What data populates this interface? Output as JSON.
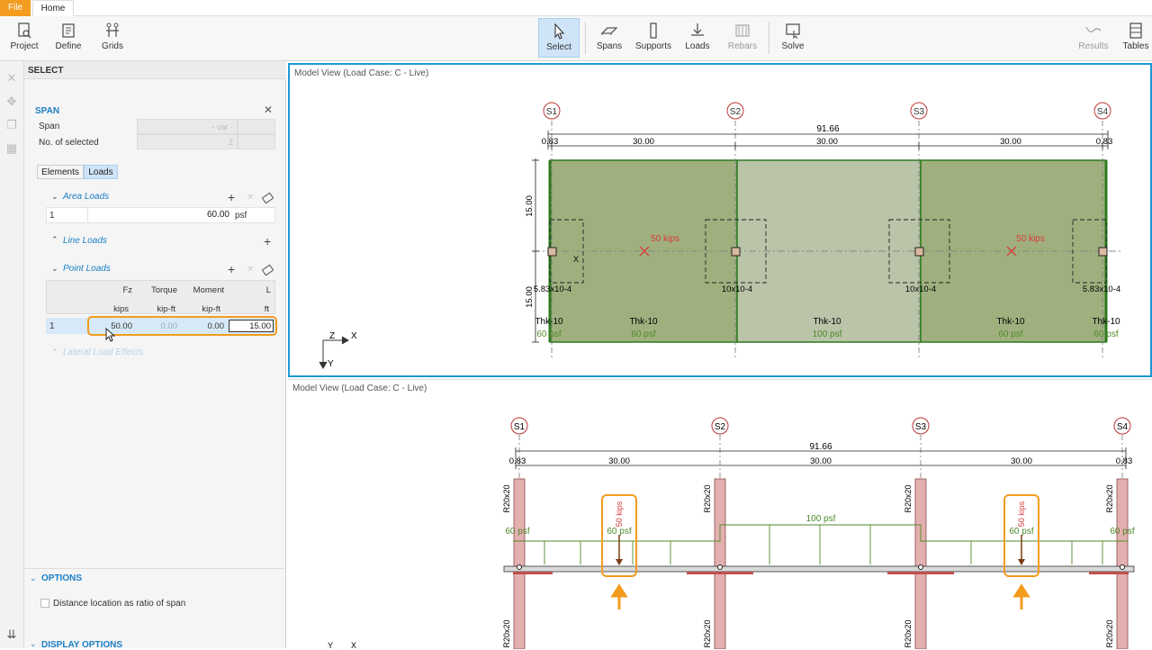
{
  "tabs": {
    "file": "File",
    "home": "Home"
  },
  "ribbon": {
    "project": "Project",
    "define": "Define",
    "grids": "Grids",
    "select": "Select",
    "spans": "Spans",
    "supports": "Supports",
    "loads": "Loads",
    "rebars": "Rebars",
    "solve": "Solve",
    "results": "Results",
    "tables": "Tables"
  },
  "panel": {
    "select_title": "SELECT",
    "span_title": "SPAN",
    "span_label": "Span",
    "span_value": "- var -",
    "selected_label": "No. of selected",
    "selected_value": "2",
    "tab_elements": "Elements",
    "tab_loads": "Loads",
    "area_loads": "Area Loads",
    "area_row_index": "1",
    "area_row_value": "60.00",
    "area_row_unit": "psf",
    "line_loads": "Line Loads",
    "point_loads": "Point Loads",
    "pt_headers": [
      "Fz",
      "Torque",
      "Moment",
      "L"
    ],
    "pt_units": [
      "kips",
      "kip-ft",
      "kip-ft",
      "ft"
    ],
    "pt_row": {
      "index": "1",
      "fz": "50.00",
      "torque": "0.00",
      "moment": "0.00",
      "l": "15.00"
    },
    "lateral": "Lateral Load Effects",
    "options_title": "OPTIONS",
    "options_check": "Distance location as ratio of span",
    "display_title": "DISPLAY OPTIONS"
  },
  "views": {
    "top_title": "Model View (Load Case: C - Live)",
    "bottom_title": "Model View (Load Case: C - Live)"
  },
  "model": {
    "grid_labels": [
      "S1",
      "S2",
      "S3",
      "S4"
    ],
    "total_dim": "91.66",
    "dims": [
      "0.83",
      "30.00",
      "30.00",
      "30.00",
      "0.83"
    ],
    "height_dims": [
      "15.00",
      "15.00"
    ],
    "point_load_label": "50 kips",
    "col_sizes": [
      "5.83x10-4",
      "10x10-4",
      "10x10-4",
      "5.83x10-4"
    ],
    "thk_labels": [
      "Thk-10",
      "Thk-10",
      "Thk-10",
      "Thk-10",
      "Thk-10"
    ],
    "psf_top": [
      "60 psf",
      "60 psf",
      "100 psf",
      "60 psf",
      "60 psf"
    ],
    "elev_psf": [
      "60 psf",
      "60 psf",
      "100 psf",
      "60 psf",
      "60 psf"
    ],
    "col_section": "R20x20",
    "axis": {
      "x": "X",
      "y": "Y",
      "z": "Z"
    }
  },
  "colors": {
    "accent": "#f39c1f",
    "slab_dark": "#9fb07e",
    "slab_light": "#b9c4a8",
    "load_red": "#d93b3b",
    "load_green": "#4f8a2b",
    "blue": "#1b7fc4"
  }
}
